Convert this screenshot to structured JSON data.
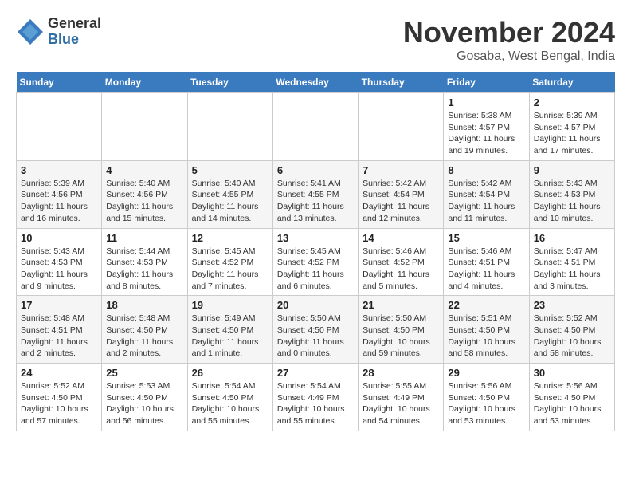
{
  "header": {
    "logo": {
      "general": "General",
      "blue": "Blue"
    },
    "title": "November 2024",
    "location": "Gosaba, West Bengal, India"
  },
  "calendar": {
    "days_of_week": [
      "Sunday",
      "Monday",
      "Tuesday",
      "Wednesday",
      "Thursday",
      "Friday",
      "Saturday"
    ],
    "weeks": [
      [
        {
          "day": "",
          "info": ""
        },
        {
          "day": "",
          "info": ""
        },
        {
          "day": "",
          "info": ""
        },
        {
          "day": "",
          "info": ""
        },
        {
          "day": "",
          "info": ""
        },
        {
          "day": "1",
          "info": "Sunrise: 5:38 AM\nSunset: 4:57 PM\nDaylight: 11 hours and 19 minutes."
        },
        {
          "day": "2",
          "info": "Sunrise: 5:39 AM\nSunset: 4:57 PM\nDaylight: 11 hours and 17 minutes."
        }
      ],
      [
        {
          "day": "3",
          "info": "Sunrise: 5:39 AM\nSunset: 4:56 PM\nDaylight: 11 hours and 16 minutes."
        },
        {
          "day": "4",
          "info": "Sunrise: 5:40 AM\nSunset: 4:56 PM\nDaylight: 11 hours and 15 minutes."
        },
        {
          "day": "5",
          "info": "Sunrise: 5:40 AM\nSunset: 4:55 PM\nDaylight: 11 hours and 14 minutes."
        },
        {
          "day": "6",
          "info": "Sunrise: 5:41 AM\nSunset: 4:55 PM\nDaylight: 11 hours and 13 minutes."
        },
        {
          "day": "7",
          "info": "Sunrise: 5:42 AM\nSunset: 4:54 PM\nDaylight: 11 hours and 12 minutes."
        },
        {
          "day": "8",
          "info": "Sunrise: 5:42 AM\nSunset: 4:54 PM\nDaylight: 11 hours and 11 minutes."
        },
        {
          "day": "9",
          "info": "Sunrise: 5:43 AM\nSunset: 4:53 PM\nDaylight: 11 hours and 10 minutes."
        }
      ],
      [
        {
          "day": "10",
          "info": "Sunrise: 5:43 AM\nSunset: 4:53 PM\nDaylight: 11 hours and 9 minutes."
        },
        {
          "day": "11",
          "info": "Sunrise: 5:44 AM\nSunset: 4:53 PM\nDaylight: 11 hours and 8 minutes."
        },
        {
          "day": "12",
          "info": "Sunrise: 5:45 AM\nSunset: 4:52 PM\nDaylight: 11 hours and 7 minutes."
        },
        {
          "day": "13",
          "info": "Sunrise: 5:45 AM\nSunset: 4:52 PM\nDaylight: 11 hours and 6 minutes."
        },
        {
          "day": "14",
          "info": "Sunrise: 5:46 AM\nSunset: 4:52 PM\nDaylight: 11 hours and 5 minutes."
        },
        {
          "day": "15",
          "info": "Sunrise: 5:46 AM\nSunset: 4:51 PM\nDaylight: 11 hours and 4 minutes."
        },
        {
          "day": "16",
          "info": "Sunrise: 5:47 AM\nSunset: 4:51 PM\nDaylight: 11 hours and 3 minutes."
        }
      ],
      [
        {
          "day": "17",
          "info": "Sunrise: 5:48 AM\nSunset: 4:51 PM\nDaylight: 11 hours and 2 minutes."
        },
        {
          "day": "18",
          "info": "Sunrise: 5:48 AM\nSunset: 4:50 PM\nDaylight: 11 hours and 2 minutes."
        },
        {
          "day": "19",
          "info": "Sunrise: 5:49 AM\nSunset: 4:50 PM\nDaylight: 11 hours and 1 minute."
        },
        {
          "day": "20",
          "info": "Sunrise: 5:50 AM\nSunset: 4:50 PM\nDaylight: 11 hours and 0 minutes."
        },
        {
          "day": "21",
          "info": "Sunrise: 5:50 AM\nSunset: 4:50 PM\nDaylight: 10 hours and 59 minutes."
        },
        {
          "day": "22",
          "info": "Sunrise: 5:51 AM\nSunset: 4:50 PM\nDaylight: 10 hours and 58 minutes."
        },
        {
          "day": "23",
          "info": "Sunrise: 5:52 AM\nSunset: 4:50 PM\nDaylight: 10 hours and 58 minutes."
        }
      ],
      [
        {
          "day": "24",
          "info": "Sunrise: 5:52 AM\nSunset: 4:50 PM\nDaylight: 10 hours and 57 minutes."
        },
        {
          "day": "25",
          "info": "Sunrise: 5:53 AM\nSunset: 4:50 PM\nDaylight: 10 hours and 56 minutes."
        },
        {
          "day": "26",
          "info": "Sunrise: 5:54 AM\nSunset: 4:50 PM\nDaylight: 10 hours and 55 minutes."
        },
        {
          "day": "27",
          "info": "Sunrise: 5:54 AM\nSunset: 4:49 PM\nDaylight: 10 hours and 55 minutes."
        },
        {
          "day": "28",
          "info": "Sunrise: 5:55 AM\nSunset: 4:49 PM\nDaylight: 10 hours and 54 minutes."
        },
        {
          "day": "29",
          "info": "Sunrise: 5:56 AM\nSunset: 4:50 PM\nDaylight: 10 hours and 53 minutes."
        },
        {
          "day": "30",
          "info": "Sunrise: 5:56 AM\nSunset: 4:50 PM\nDaylight: 10 hours and 53 minutes."
        }
      ]
    ]
  }
}
